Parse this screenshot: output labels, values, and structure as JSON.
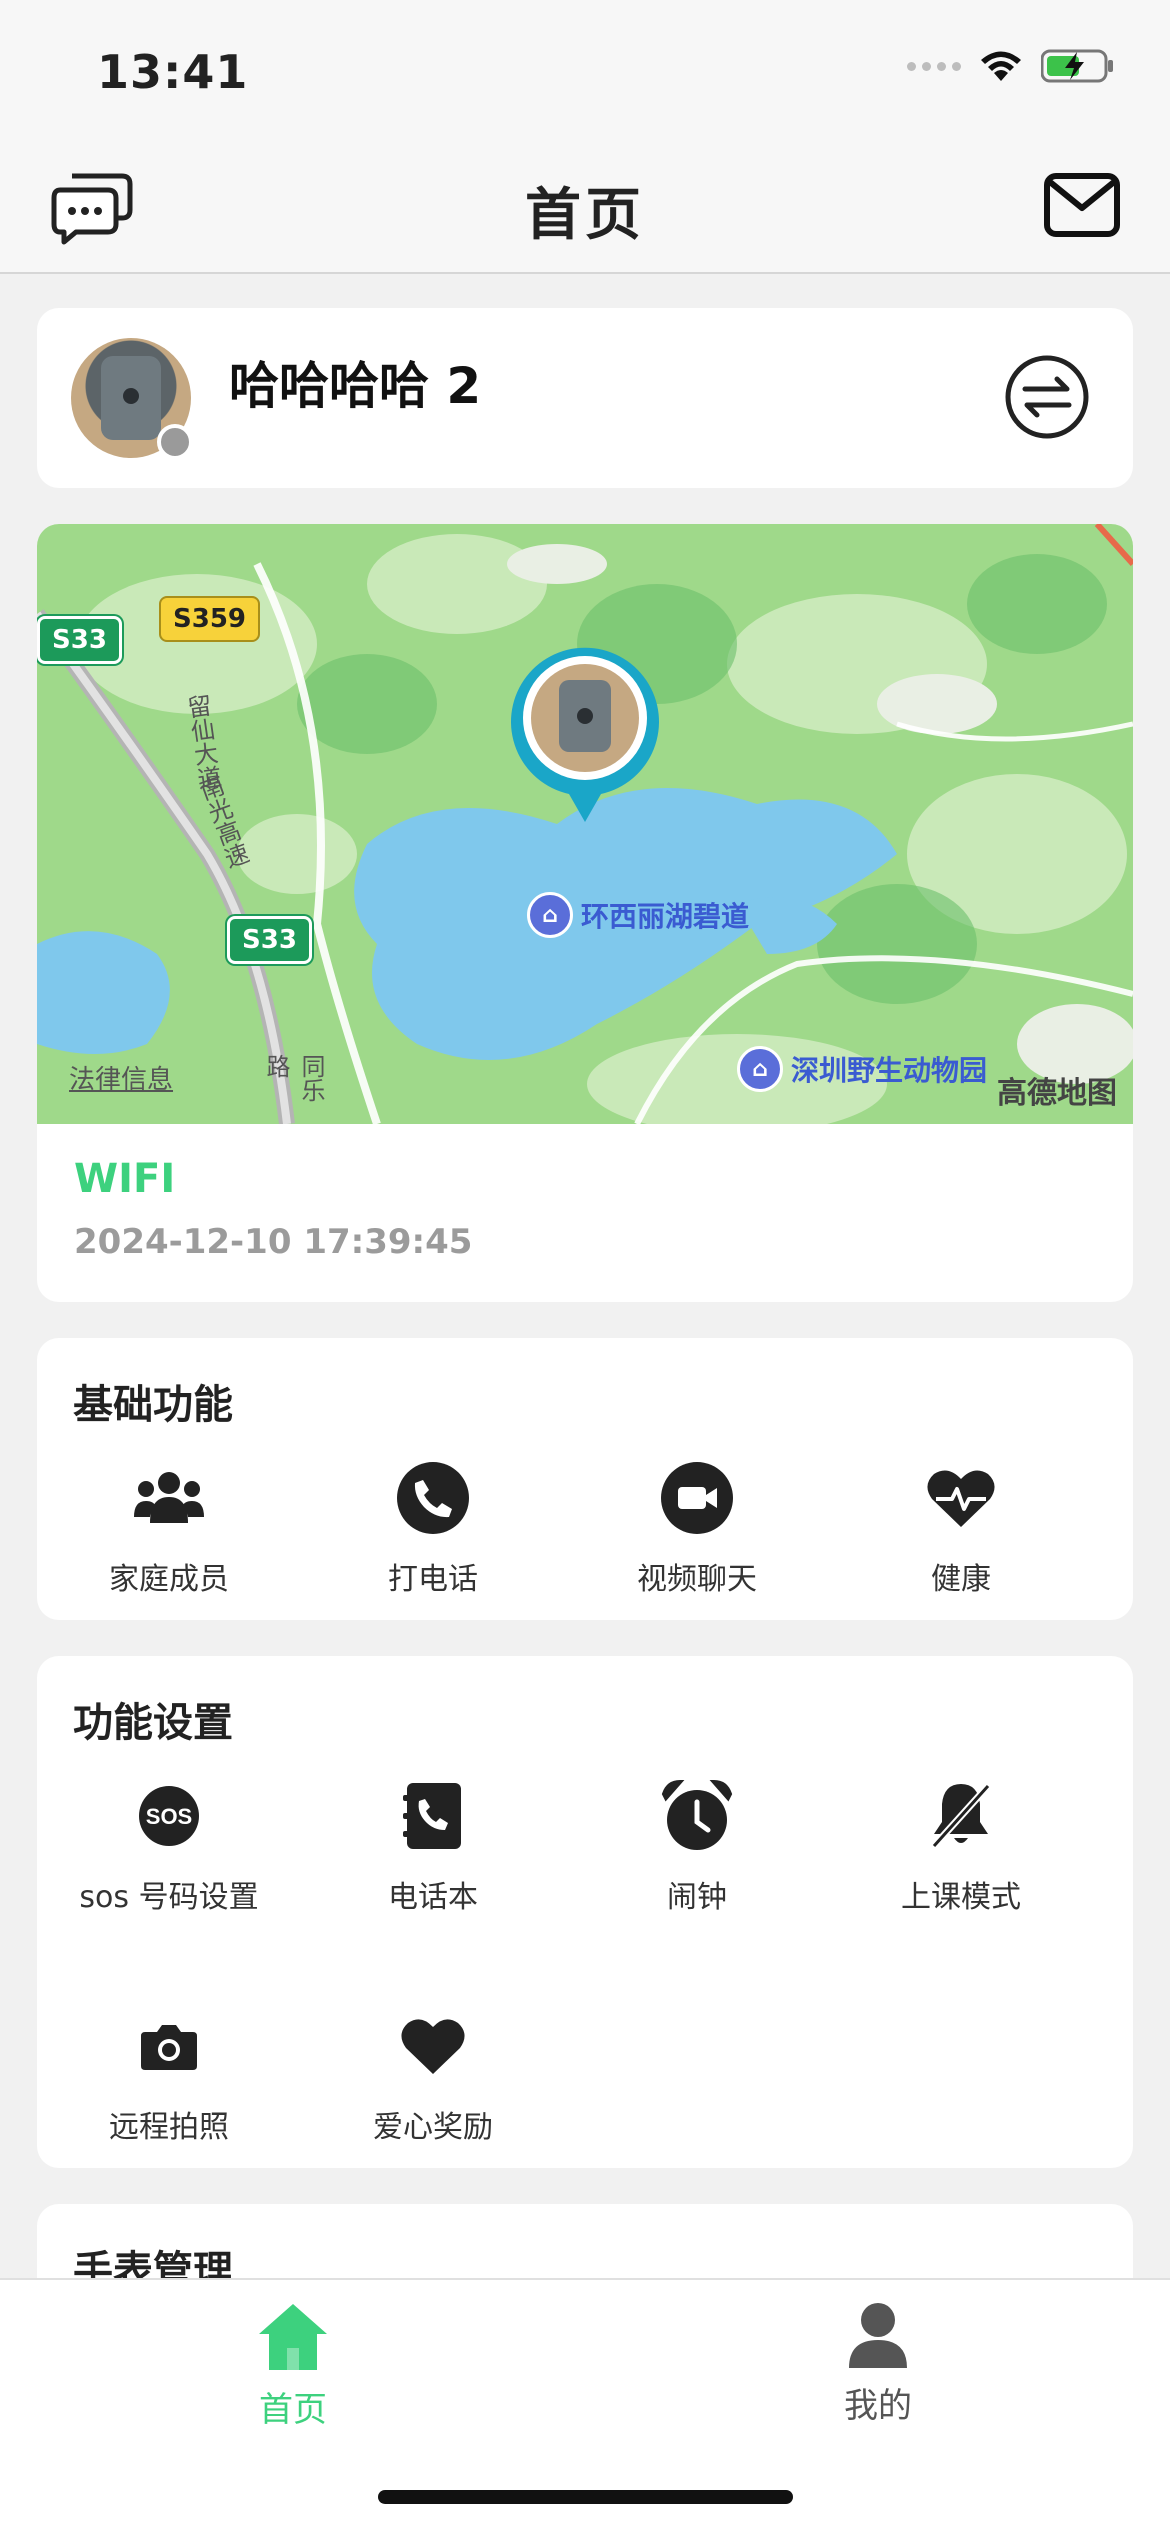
{
  "status_bar": {
    "time": "13:41"
  },
  "nav": {
    "title": "首页"
  },
  "device": {
    "name": "哈哈哈哈 2"
  },
  "map": {
    "legal_link": "法律信息",
    "brand": "高德地图",
    "pois": [
      "环西丽湖碧道",
      "深圳野生动物园"
    ],
    "roads": [
      "S359",
      "S33",
      "S33"
    ],
    "road_names": [
      "留仙大道",
      "南光高速",
      "同乐路"
    ]
  },
  "location": {
    "type": "WIFI",
    "time": "2024-12-10 17:39:45"
  },
  "basic": {
    "title": "基础功能",
    "items": [
      {
        "label": "家庭成员",
        "icon": "family-icon"
      },
      {
        "label": "打电话",
        "icon": "phone-icon"
      },
      {
        "label": "视频聊天",
        "icon": "video-icon"
      },
      {
        "label": "健康",
        "icon": "health-icon"
      }
    ]
  },
  "settings": {
    "title": "功能设置",
    "items": [
      {
        "label": "sos 号码设置",
        "icon": "sos-icon"
      },
      {
        "label": "电话本",
        "icon": "phonebook-icon"
      },
      {
        "label": "闹钟",
        "icon": "alarm-icon"
      },
      {
        "label": "上课模式",
        "icon": "bell-off-icon"
      },
      {
        "label": "远程拍照",
        "icon": "camera-icon"
      },
      {
        "label": "爱心奖励",
        "icon": "heart-icon"
      }
    ]
  },
  "watch": {
    "title": "手表管理"
  },
  "tabs": [
    {
      "label": "首页",
      "active": true
    },
    {
      "label": "我的",
      "active": false
    }
  ],
  "colors": {
    "accent": "#3dd17e",
    "marker": "#1aa6c8"
  }
}
